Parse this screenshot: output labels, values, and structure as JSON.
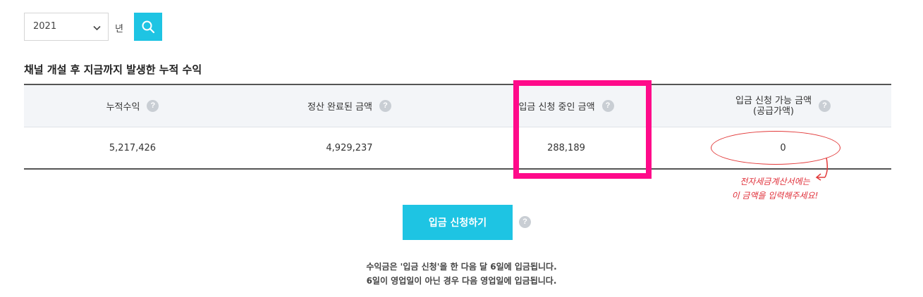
{
  "filter": {
    "year_value": "2021",
    "year_unit": "년"
  },
  "section": {
    "title": "채널 개설 후 지금까지 발생한 누적 수익"
  },
  "table": {
    "headers": [
      {
        "label": "누적수익"
      },
      {
        "label": "정산 완료된 금액"
      },
      {
        "label": "입금 신청 중인 금액"
      },
      {
        "label_line1": "입금 신청 가능 금액",
        "label_line2": "(공급가액)"
      }
    ],
    "values": [
      "5,217,426",
      "4,929,237",
      "288,189",
      "0"
    ]
  },
  "annotation": {
    "line1": "전자세금계산서에는",
    "line2": "이 금액을 입력해주세요!",
    "color": "#e0303a"
  },
  "highlight_color": "#ff0a8a",
  "action": {
    "submit_label": "입금 신청하기"
  },
  "help_glyph": "?",
  "notice": {
    "line1": "수익금은 '입금 신청'을 한 다음 달 6일에 입금됩니다.",
    "line2": "6일이 영업일이 아닌 경우 다음 영업일에 입금됩니다."
  },
  "colors": {
    "accent": "#1ec4e3",
    "header_bg": "#f3f5f8"
  },
  "icons": [
    "chevron-down-icon",
    "search-icon",
    "help-icon"
  ]
}
